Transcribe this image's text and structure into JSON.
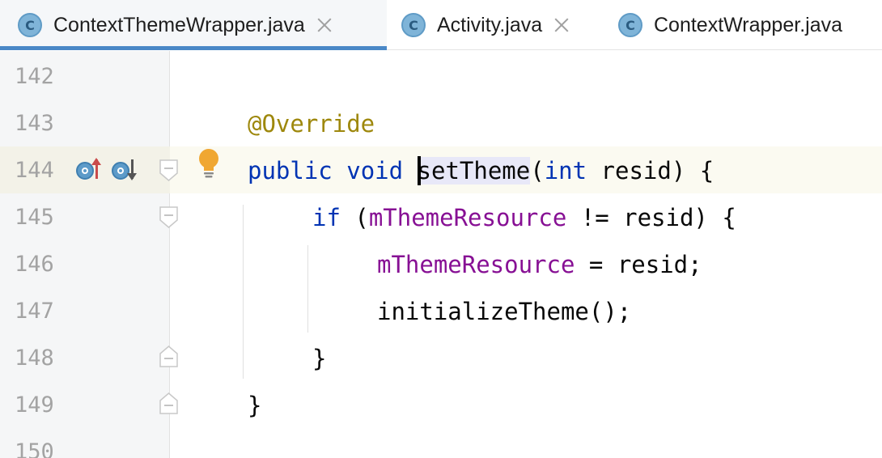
{
  "tabs": [
    {
      "icon": "C",
      "label": "ContextThemeWrapper.java",
      "active": true
    },
    {
      "icon": "C",
      "label": "Activity.java",
      "active": false
    },
    {
      "icon": "C",
      "label": "ContextWrapper.java",
      "active": false
    }
  ],
  "editor": {
    "line_numbers": [
      "142",
      "143",
      "144",
      "145",
      "146",
      "147",
      "148",
      "149",
      "150"
    ],
    "code": {
      "l143": {
        "annotation": "@Override"
      },
      "l144": {
        "kw1": "public",
        "kw2": "void",
        "method": "setTheme",
        "paren_open": "(",
        "kw3": "int",
        "rest": " resid) {"
      },
      "l145": {
        "kw": "if",
        "open": " (",
        "field": "mThemeResource",
        "rest": " != resid) {"
      },
      "l146": {
        "field": "mThemeResource",
        "rest": " = resid;"
      },
      "l147": {
        "text": "initializeTheme();"
      },
      "l148": {
        "text": "}"
      },
      "l149": {
        "text": "}"
      }
    }
  },
  "colors": {
    "keyword": "#0033b3",
    "annotation": "#9e880d",
    "field": "#871094",
    "tab_underline": "#4a88c7"
  },
  "icons": {
    "tab": "class-c-icon",
    "gutter_implemented": "implemented-method-icon",
    "gutter_override": "overriding-method-icon",
    "intention": "lightbulb-icon",
    "fold": "fold-marker-icon"
  }
}
